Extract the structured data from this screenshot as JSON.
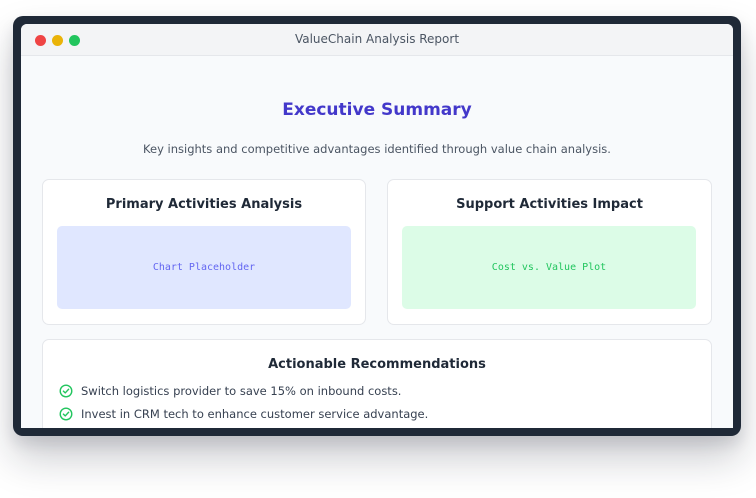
{
  "window": {
    "title": "ValueChain Analysis Report"
  },
  "summary": {
    "heading": "Executive Summary",
    "subheading": "Key insights and competitive advantages identified through value chain analysis."
  },
  "cards": [
    {
      "title": "Primary Activities Analysis",
      "placeholder": "Chart Placeholder"
    },
    {
      "title": "Support Activities Impact",
      "placeholder": "Cost vs. Value Plot"
    }
  ],
  "recommendations": {
    "title": "Actionable Recommendations",
    "items": [
      "Switch logistics provider to save 15% on inbound costs.",
      "Invest in CRM tech to enhance customer service advantage."
    ],
    "icon": "check-circle-icon"
  },
  "colors": {
    "accent": "#4338ca",
    "chart_placeholder_bg": "#e0e7ff",
    "plot_placeholder_bg": "#dcfce7",
    "check": "#22c55e",
    "close_dot": "#ef4444",
    "minimize_dot": "#eab308",
    "maximize_dot": "#22c55e"
  }
}
